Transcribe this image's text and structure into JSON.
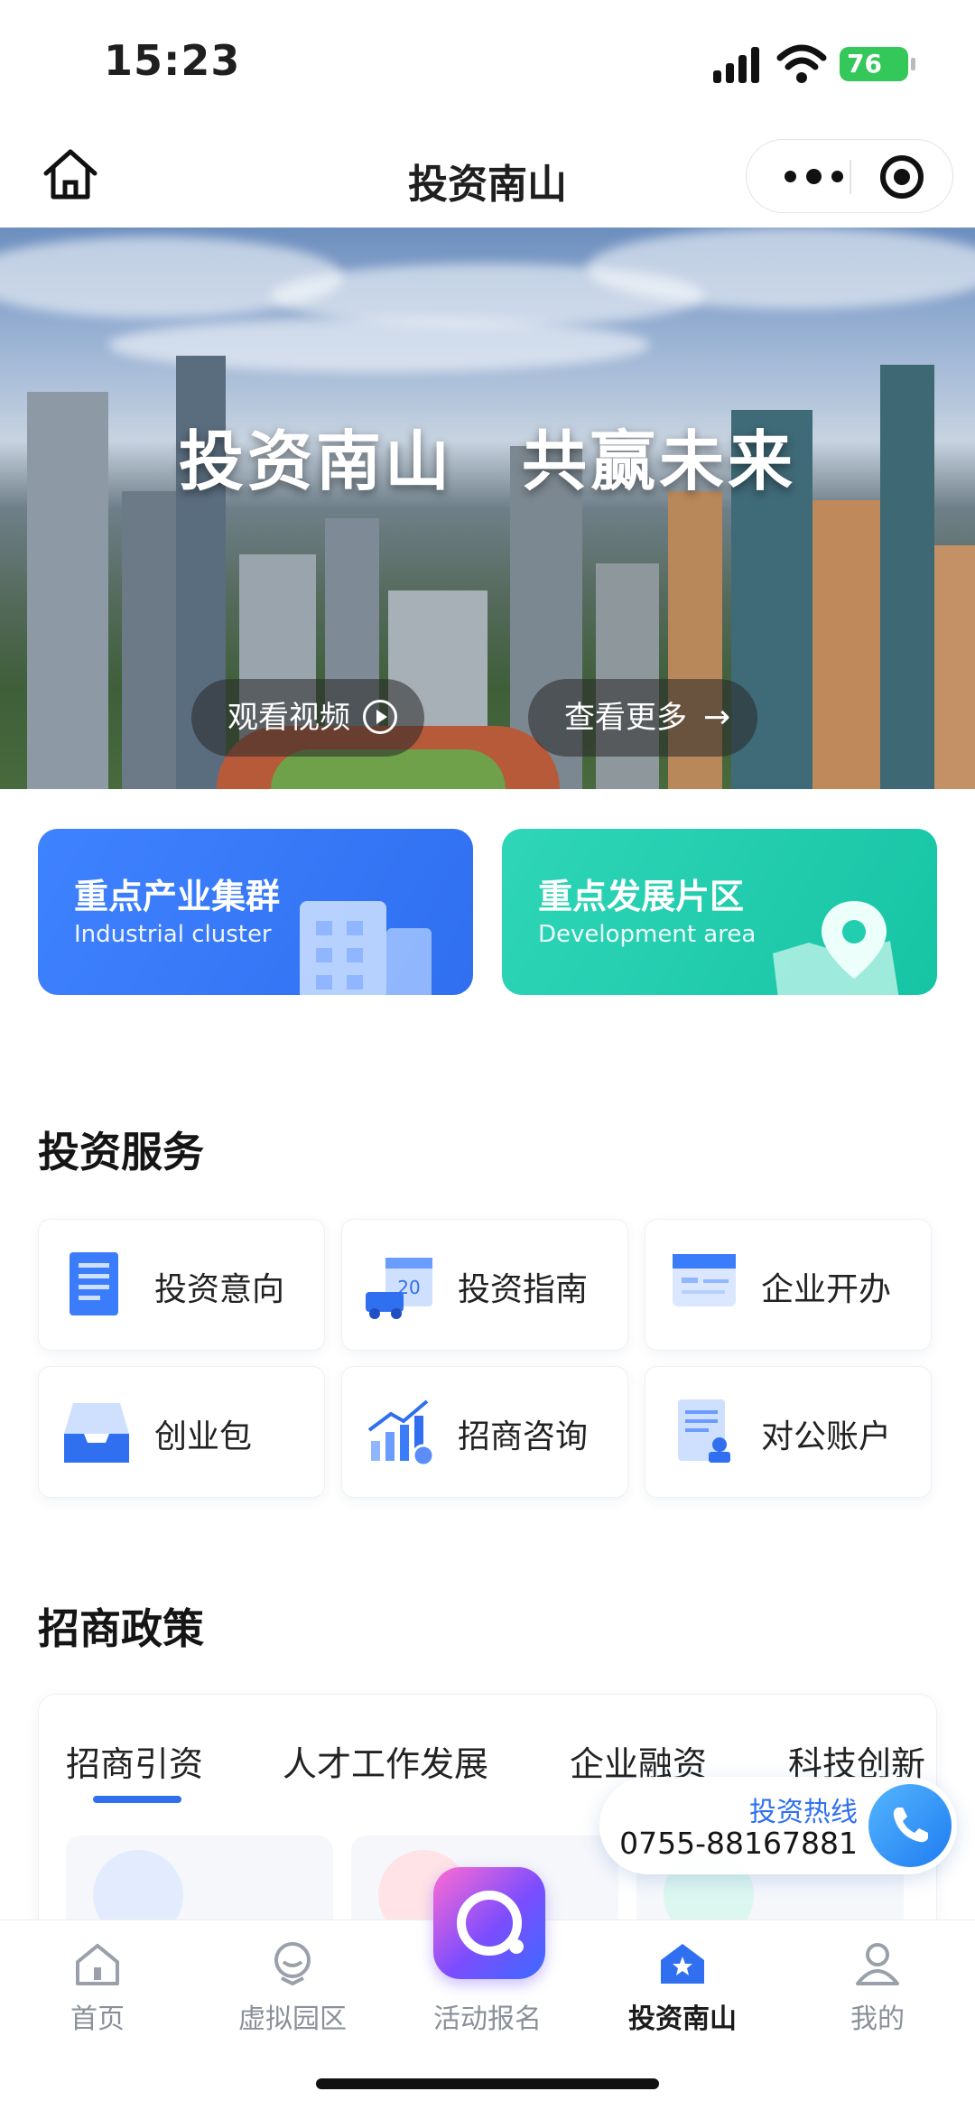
{
  "status_bar": {
    "time": "15:23",
    "battery": "76"
  },
  "nav": {
    "title": "投资南山"
  },
  "banner": {
    "title": "投资南山　共赢未来",
    "watch_video": "观看视频",
    "see_more": "查看更多"
  },
  "features": [
    {
      "title": "重点产业集群",
      "subtitle": "Industrial cluster",
      "color": "#3b7cfb"
    },
    {
      "title": "重点发展片区",
      "subtitle": "Development area",
      "color": "#22cdb0"
    }
  ],
  "services": {
    "title": "投资服务",
    "items": [
      {
        "label": "投资意向",
        "icon": "document-icon"
      },
      {
        "label": "投资指南",
        "icon": "calendar-truck-icon"
      },
      {
        "label": "企业开办",
        "icon": "card-icon"
      },
      {
        "label": "创业包",
        "icon": "inbox-icon"
      },
      {
        "label": "招商咨询",
        "icon": "growth-chart-icon"
      },
      {
        "label": "对公账户",
        "icon": "account-doc-icon"
      }
    ]
  },
  "policy": {
    "title": "招商政策",
    "tabs": [
      "招商引资",
      "人才工作发展",
      "企业融资",
      "科技创新"
    ],
    "active_tab": "招商引资"
  },
  "hotline": {
    "label": "投资热线",
    "number": "0755-88167881"
  },
  "tabbar": {
    "items": [
      {
        "label": "首页",
        "icon": "home-icon"
      },
      {
        "label": "虚拟园区",
        "icon": "avatar-icon"
      },
      {
        "label": "活动报名",
        "icon": "activity-icon"
      },
      {
        "label": "投资南山",
        "icon": "investment-icon"
      },
      {
        "label": "我的",
        "icon": "profile-icon"
      }
    ],
    "active": "投资南山"
  },
  "colors": {
    "accent": "#2f6ff0",
    "teal": "#22cdb0",
    "text": "#151515"
  }
}
